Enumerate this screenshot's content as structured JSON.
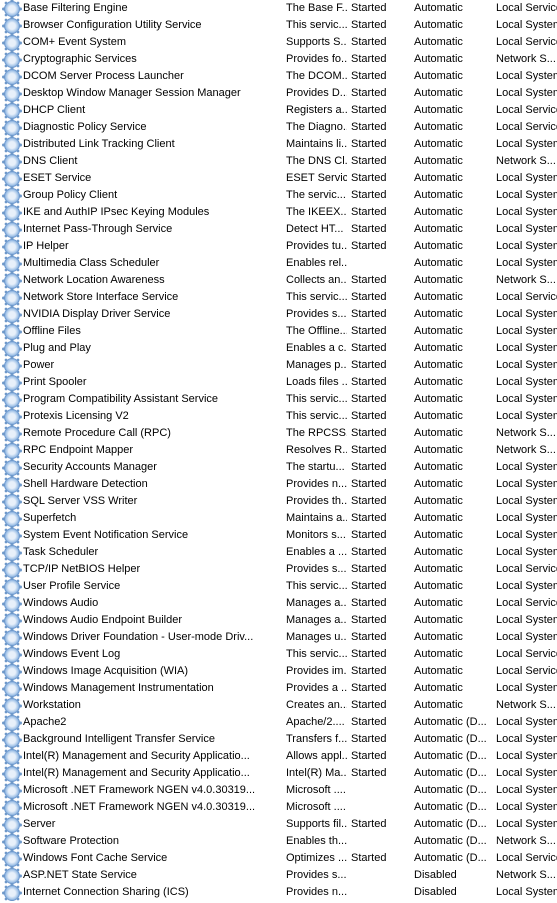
{
  "services": [
    {
      "name": "Base Filtering Engine",
      "desc": "The Base F...",
      "status": "Started",
      "startup": "Automatic",
      "logon": "Local Service"
    },
    {
      "name": "Browser Configuration Utility Service",
      "desc": "This servic...",
      "status": "Started",
      "startup": "Automatic",
      "logon": "Local System"
    },
    {
      "name": "COM+ Event System",
      "desc": "Supports S...",
      "status": "Started",
      "startup": "Automatic",
      "logon": "Local Service"
    },
    {
      "name": "Cryptographic Services",
      "desc": "Provides fo...",
      "status": "Started",
      "startup": "Automatic",
      "logon": "Network S..."
    },
    {
      "name": "DCOM Server Process Launcher",
      "desc": "The DCOM...",
      "status": "Started",
      "startup": "Automatic",
      "logon": "Local System"
    },
    {
      "name": "Desktop Window Manager Session Manager",
      "desc": "Provides D...",
      "status": "Started",
      "startup": "Automatic",
      "logon": "Local System"
    },
    {
      "name": "DHCP Client",
      "desc": "Registers a...",
      "status": "Started",
      "startup": "Automatic",
      "logon": "Local Service"
    },
    {
      "name": "Diagnostic Policy Service",
      "desc": "The Diagno...",
      "status": "Started",
      "startup": "Automatic",
      "logon": "Local Service"
    },
    {
      "name": "Distributed Link Tracking Client",
      "desc": "Maintains li...",
      "status": "Started",
      "startup": "Automatic",
      "logon": "Local System"
    },
    {
      "name": "DNS Client",
      "desc": "The DNS Cl...",
      "status": "Started",
      "startup": "Automatic",
      "logon": "Network S..."
    },
    {
      "name": "ESET Service",
      "desc": "ESET Service",
      "status": "Started",
      "startup": "Automatic",
      "logon": "Local System"
    },
    {
      "name": "Group Policy Client",
      "desc": "The servic...",
      "status": "Started",
      "startup": "Automatic",
      "logon": "Local System"
    },
    {
      "name": "IKE and AuthIP IPsec Keying Modules",
      "desc": "The IKEEX...",
      "status": "Started",
      "startup": "Automatic",
      "logon": "Local System"
    },
    {
      "name": "Internet Pass-Through Service",
      "desc": "Detect HT...",
      "status": "Started",
      "startup": "Automatic",
      "logon": "Local System"
    },
    {
      "name": "IP Helper",
      "desc": "Provides tu...",
      "status": "Started",
      "startup": "Automatic",
      "logon": "Local System"
    },
    {
      "name": "Multimedia Class Scheduler",
      "desc": "Enables rel...",
      "status": "",
      "startup": "Automatic",
      "logon": "Local System"
    },
    {
      "name": "Network Location Awareness",
      "desc": "Collects an...",
      "status": "Started",
      "startup": "Automatic",
      "logon": "Network S..."
    },
    {
      "name": "Network Store Interface Service",
      "desc": "This servic...",
      "status": "Started",
      "startup": "Automatic",
      "logon": "Local Service"
    },
    {
      "name": "NVIDIA Display Driver Service",
      "desc": "Provides s...",
      "status": "Started",
      "startup": "Automatic",
      "logon": "Local System"
    },
    {
      "name": "Offline Files",
      "desc": "The Offline...",
      "status": "Started",
      "startup": "Automatic",
      "logon": "Local System"
    },
    {
      "name": "Plug and Play",
      "desc": "Enables a c...",
      "status": "Started",
      "startup": "Automatic",
      "logon": "Local System"
    },
    {
      "name": "Power",
      "desc": "Manages p...",
      "status": "Started",
      "startup": "Automatic",
      "logon": "Local System"
    },
    {
      "name": "Print Spooler",
      "desc": "Loads files ...",
      "status": "Started",
      "startup": "Automatic",
      "logon": "Local System"
    },
    {
      "name": "Program Compatibility Assistant Service",
      "desc": "This servic...",
      "status": "Started",
      "startup": "Automatic",
      "logon": "Local System"
    },
    {
      "name": "Protexis Licensing V2",
      "desc": "This servic...",
      "status": "Started",
      "startup": "Automatic",
      "logon": "Local System"
    },
    {
      "name": "Remote Procedure Call (RPC)",
      "desc": "The RPCSS...",
      "status": "Started",
      "startup": "Automatic",
      "logon": "Network S..."
    },
    {
      "name": "RPC Endpoint Mapper",
      "desc": "Resolves R...",
      "status": "Started",
      "startup": "Automatic",
      "logon": "Network S..."
    },
    {
      "name": "Security Accounts Manager",
      "desc": "The startu...",
      "status": "Started",
      "startup": "Automatic",
      "logon": "Local System"
    },
    {
      "name": "Shell Hardware Detection",
      "desc": "Provides n...",
      "status": "Started",
      "startup": "Automatic",
      "logon": "Local System"
    },
    {
      "name": "SQL Server VSS Writer",
      "desc": "Provides th...",
      "status": "Started",
      "startup": "Automatic",
      "logon": "Local System"
    },
    {
      "name": "Superfetch",
      "desc": "Maintains a...",
      "status": "Started",
      "startup": "Automatic",
      "logon": "Local System"
    },
    {
      "name": "System Event Notification Service",
      "desc": "Monitors s...",
      "status": "Started",
      "startup": "Automatic",
      "logon": "Local System"
    },
    {
      "name": "Task Scheduler",
      "desc": "Enables a ...",
      "status": "Started",
      "startup": "Automatic",
      "logon": "Local System"
    },
    {
      "name": "TCP/IP NetBIOS Helper",
      "desc": "Provides s...",
      "status": "Started",
      "startup": "Automatic",
      "logon": "Local Service"
    },
    {
      "name": "User Profile Service",
      "desc": "This servic...",
      "status": "Started",
      "startup": "Automatic",
      "logon": "Local System"
    },
    {
      "name": "Windows Audio",
      "desc": "Manages a...",
      "status": "Started",
      "startup": "Automatic",
      "logon": "Local Service"
    },
    {
      "name": "Windows Audio Endpoint Builder",
      "desc": "Manages a...",
      "status": "Started",
      "startup": "Automatic",
      "logon": "Local System"
    },
    {
      "name": "Windows Driver Foundation - User-mode Driv...",
      "desc": "Manages u...",
      "status": "Started",
      "startup": "Automatic",
      "logon": "Local System"
    },
    {
      "name": "Windows Event Log",
      "desc": "This servic...",
      "status": "Started",
      "startup": "Automatic",
      "logon": "Local Service"
    },
    {
      "name": "Windows Image Acquisition (WIA)",
      "desc": "Provides im...",
      "status": "Started",
      "startup": "Automatic",
      "logon": "Local Service"
    },
    {
      "name": "Windows Management Instrumentation",
      "desc": "Provides a ...",
      "status": "Started",
      "startup": "Automatic",
      "logon": "Local System"
    },
    {
      "name": "Workstation",
      "desc": "Creates an...",
      "status": "Started",
      "startup": "Automatic",
      "logon": "Network S..."
    },
    {
      "name": "Apache2",
      "desc": "Apache/2....",
      "status": "Started",
      "startup": "Automatic (D...",
      "logon": "Local System"
    },
    {
      "name": "Background Intelligent Transfer Service",
      "desc": "Transfers f...",
      "status": "Started",
      "startup": "Automatic (D...",
      "logon": "Local System"
    },
    {
      "name": "Intel(R) Management and Security Applicatio...",
      "desc": "Allows appl...",
      "status": "Started",
      "startup": "Automatic (D...",
      "logon": "Local System"
    },
    {
      "name": "Intel(R) Management and Security Applicatio...",
      "desc": "Intel(R) Ma...",
      "status": "Started",
      "startup": "Automatic (D...",
      "logon": "Local System"
    },
    {
      "name": "Microsoft .NET Framework NGEN v4.0.30319...",
      "desc": "Microsoft ....",
      "status": "",
      "startup": "Automatic (D...",
      "logon": "Local System"
    },
    {
      "name": "Microsoft .NET Framework NGEN v4.0.30319...",
      "desc": "Microsoft ....",
      "status": "",
      "startup": "Automatic (D...",
      "logon": "Local System"
    },
    {
      "name": "Server",
      "desc": "Supports fil...",
      "status": "Started",
      "startup": "Automatic (D...",
      "logon": "Local System"
    },
    {
      "name": "Software Protection",
      "desc": "Enables th...",
      "status": "",
      "startup": "Automatic (D...",
      "logon": "Network S..."
    },
    {
      "name": "Windows Font Cache Service",
      "desc": "Optimizes ...",
      "status": "Started",
      "startup": "Automatic (D...",
      "logon": "Local Service"
    },
    {
      "name": "ASP.NET State Service",
      "desc": "Provides s...",
      "status": "",
      "startup": "Disabled",
      "logon": "Network S..."
    },
    {
      "name": "Internet Connection Sharing (ICS)",
      "desc": "Provides n...",
      "status": "",
      "startup": "Disabled",
      "logon": "Local System"
    }
  ]
}
